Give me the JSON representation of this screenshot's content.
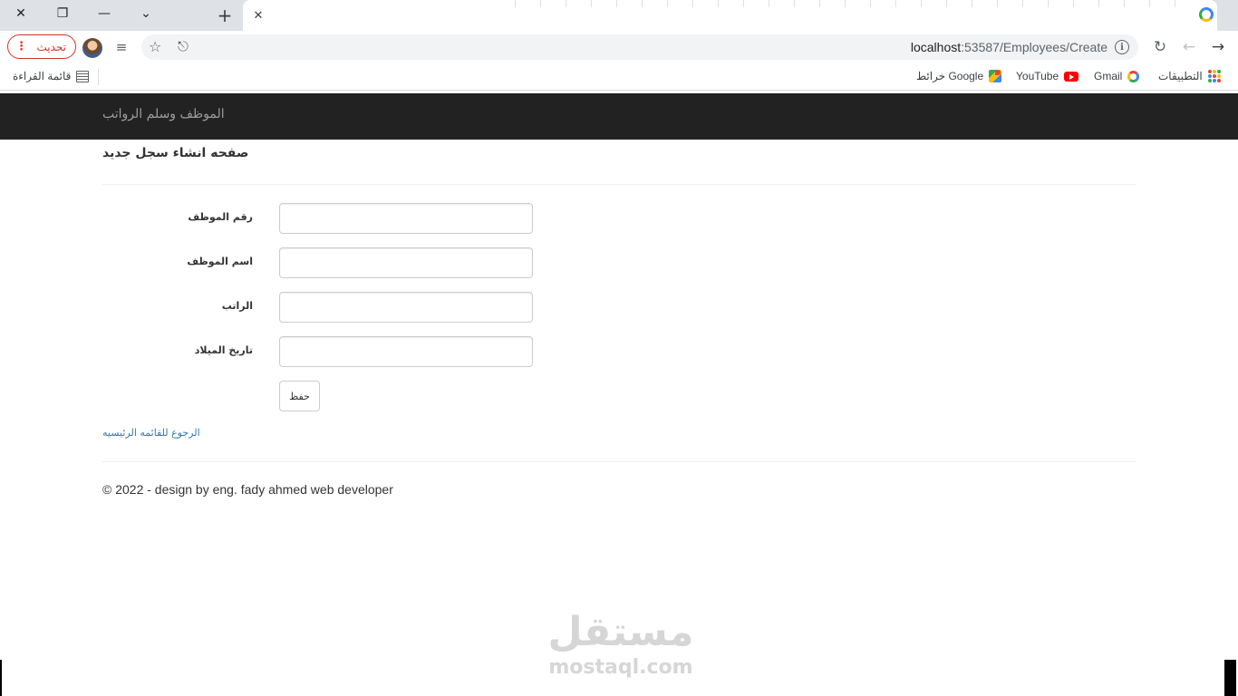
{
  "browser": {
    "update_label": "تحديث",
    "kebab": "⋮",
    "url_host": "localhost",
    "url_path": ":53587/Employees/Create",
    "info_glyph": "i",
    "win_close": "✕",
    "win_restore": "❐",
    "win_minimize": "—",
    "tab_search": "⌄",
    "new_tab": "+",
    "tab_close": "✕",
    "star": "☆",
    "share": "⎋",
    "reload": "↻",
    "back": "←",
    "forward": "→",
    "queue": "≡"
  },
  "bookmarks": {
    "apps": "التطبيقات",
    "gmail": "Gmail",
    "youtube": "YouTube",
    "maps": "خرائط Google",
    "reading_list": "قائمة القراءة"
  },
  "navbar": {
    "brand": "الموظف وسلم الرواتب"
  },
  "page": {
    "heading": "صفحه انشاء سجل جديد",
    "fields": [
      {
        "label": "رقم الموظف",
        "value": ""
      },
      {
        "label": "اسم الموظف",
        "value": ""
      },
      {
        "label": "الراتب",
        "value": ""
      },
      {
        "label": "تاريخ الميلاد",
        "value": ""
      }
    ],
    "save_label": "حفظ",
    "back_link": "الرجوع للقائمه الرئيسيه",
    "footer": "© 2022 - design by eng. fady ahmed web developer"
  },
  "watermark": {
    "arabic": "مستقل",
    "latin": "mostaql.com"
  },
  "colors": {
    "navbar_bg": "#222222",
    "brand_text": "#9d9d9d",
    "link": "#337ab7",
    "update_red": "#d93025"
  }
}
